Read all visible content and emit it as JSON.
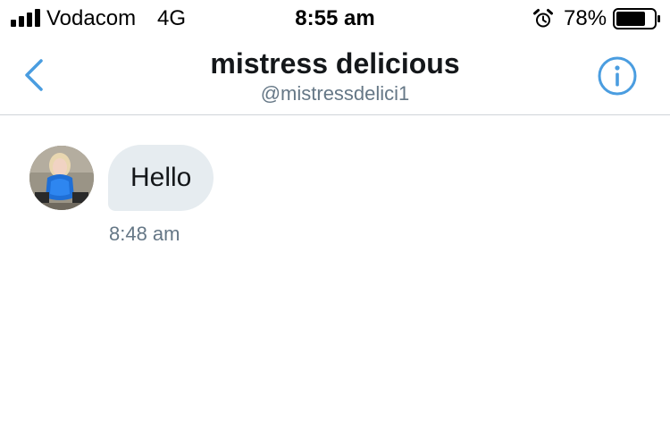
{
  "status_bar": {
    "carrier": "Vodacom",
    "network": "4G",
    "time": "8:55 am",
    "battery_percent": "78%",
    "battery_level": 0.78,
    "icons": [
      "signal-bars-icon",
      "alarm-clock-icon",
      "battery-icon"
    ]
  },
  "header": {
    "title": "mistress delicious",
    "handle": "@mistressdelici1",
    "back_icon": "chevron-left-icon",
    "info_icon": "info-circle-icon",
    "accent_color": "#4a9de0"
  },
  "conversation": {
    "messages": [
      {
        "text": "Hello",
        "time": "8:48 am",
        "direction": "received",
        "avatar": "avatar-photo"
      }
    ]
  },
  "colors": {
    "bubble_background": "#e6ecf0",
    "secondary_text": "#657786",
    "divider": "#cfd4d9"
  }
}
